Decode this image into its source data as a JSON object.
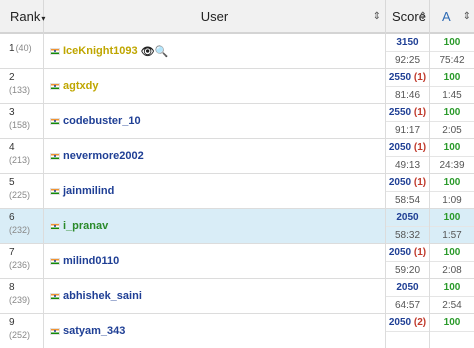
{
  "header": {
    "rank": "Rank",
    "rank_caret": "▾",
    "user": "User",
    "user_sort": "⇕",
    "score": "Score",
    "score_sort": "⇕",
    "a": "A",
    "a_sort": "⇕"
  },
  "icons": {
    "flag": "india-flag-icon",
    "eye": "👁",
    "search": "🔍"
  },
  "rows": [
    {
      "rank": "1",
      "prev": "(40)",
      "user": "IceKnight1093",
      "color": "yellow",
      "score": "3150",
      "hacks": "",
      "time": "92:25",
      "a_score": "100",
      "a_time": "75:42",
      "icons": true
    },
    {
      "rank": "2",
      "prev": "(133)",
      "user": "agtxdy",
      "color": "yellow",
      "score": "2550",
      "hacks": "(1)",
      "time": "81:46",
      "a_score": "100",
      "a_time": "1:45"
    },
    {
      "rank": "3",
      "prev": "(158)",
      "user": "codebuster_10",
      "color": "blue",
      "score": "2550",
      "hacks": "(1)",
      "time": "91:17",
      "a_score": "100",
      "a_time": "2:05"
    },
    {
      "rank": "4",
      "prev": "(213)",
      "user": "nevermore2002",
      "color": "blue",
      "score": "2050",
      "hacks": "(1)",
      "time": "49:13",
      "a_score": "100",
      "a_time": "24:39"
    },
    {
      "rank": "5",
      "prev": "(225)",
      "user": "jainmilind",
      "color": "blue",
      "score": "2050",
      "hacks": "(1)",
      "time": "58:54",
      "a_score": "100",
      "a_time": "1:09"
    },
    {
      "rank": "6",
      "prev": "(232)",
      "user": "i_pranav",
      "color": "green",
      "score": "2050",
      "hacks": "",
      "time": "58:32",
      "a_score": "100",
      "a_time": "1:57",
      "highlight": true
    },
    {
      "rank": "7",
      "prev": "(236)",
      "user": "milind0110",
      "color": "blue",
      "score": "2050",
      "hacks": "(1)",
      "time": "59:20",
      "a_score": "100",
      "a_time": "2:08"
    },
    {
      "rank": "8",
      "prev": "(239)",
      "user": "abhishek_saini",
      "color": "blue",
      "score": "2050",
      "hacks": "",
      "time": "64:57",
      "a_score": "100",
      "a_time": "2:54"
    },
    {
      "rank": "9",
      "prev": "(252)",
      "user": "satyam_343",
      "color": "blue",
      "score": "2050",
      "hacks": "(2)",
      "time": "",
      "a_score": "100",
      "a_time": ""
    }
  ]
}
